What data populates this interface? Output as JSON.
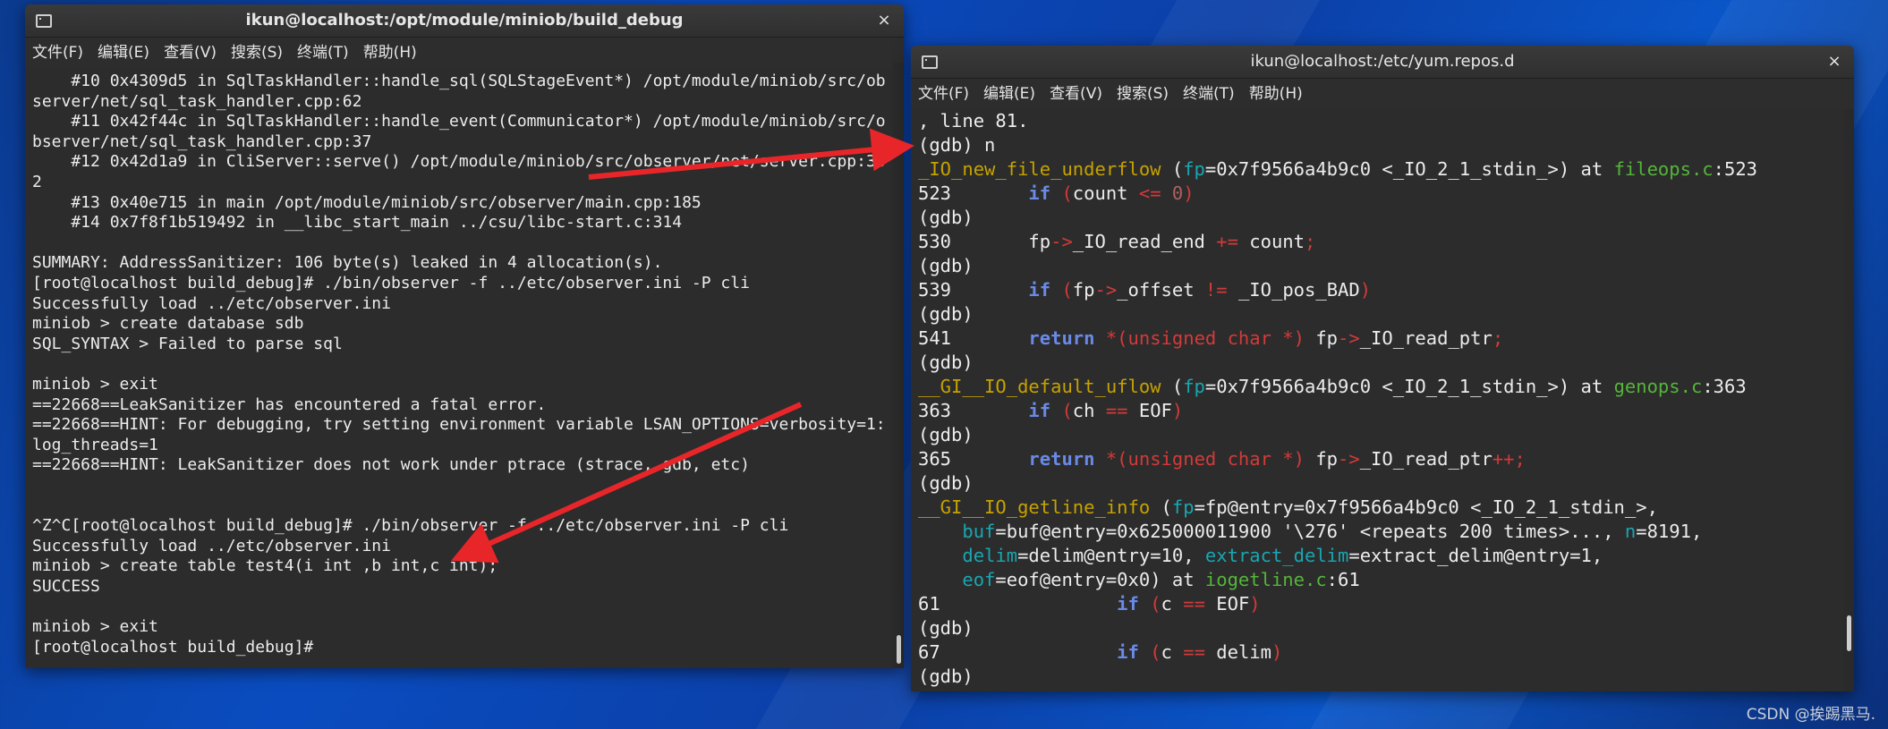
{
  "desktop": {
    "watermark": "CSDN @挨踢黑马."
  },
  "left_window": {
    "title": "ikun@localhost:/opt/module/miniob/build_debug",
    "close": "×",
    "menu": [
      "文件(F)",
      "编辑(E)",
      "查看(V)",
      "搜索(S)",
      "终端(T)",
      "帮助(H)"
    ],
    "lines": [
      "    #10 0x4309d5 in SqlTaskHandler::handle_sql(SQLStageEvent*) /opt/module/miniob/src/ob",
      "server/net/sql_task_handler.cpp:62",
      "    #11 0x42f44c in SqlTaskHandler::handle_event(Communicator*) /opt/module/miniob/src/o",
      "bserver/net/sql_task_handler.cpp:37",
      "    #12 0x42d1a9 in CliServer::serve() /opt/module/miniob/src/observer/net/server.cpp:33",
      "2",
      "    #13 0x40e715 in main /opt/module/miniob/src/observer/main.cpp:185",
      "    #14 0x7f8f1b519492 in __libc_start_main ../csu/libc-start.c:314",
      "",
      "SUMMARY: AddressSanitizer: 106 byte(s) leaked in 4 allocation(s).",
      "[root@localhost build_debug]# ./bin/observer -f ../etc/observer.ini -P cli",
      "Successfully load ../etc/observer.ini",
      "miniob > create database sdb",
      "SQL_SYNTAX > Failed to parse sql",
      "",
      "miniob > exit",
      "==22668==LeakSanitizer has encountered a fatal error.",
      "==22668==HINT: For debugging, try setting environment variable LSAN_OPTIONS=verbosity=1:",
      "log_threads=1",
      "==22668==HINT: LeakSanitizer does not work under ptrace (strace, gdb, etc)",
      "",
      "",
      "^Z^C[root@localhost build_debug]# ./bin/observer -f ../etc/observer.ini -P cli",
      "Successfully load ../etc/observer.ini",
      "miniob > create table test4(i int ,b int,c int);",
      "SUCCESS",
      "",
      "miniob > exit",
      "[root@localhost build_debug]#"
    ]
  },
  "right_window": {
    "title": "ikun@localhost:/etc/yum.repos.d",
    "close": "×",
    "menu": [
      "文件(F)",
      "编辑(E)",
      "查看(V)",
      "搜索(S)",
      "终端(T)",
      "帮助(H)"
    ],
    "lines": [
      [
        {
          "t": ", line 81."
        }
      ],
      [
        {
          "t": "(gdb) n"
        }
      ],
      [
        {
          "t": "_IO_new_file_underflow",
          "c": "c-fn"
        },
        {
          "t": " ("
        },
        {
          "t": "fp",
          "c": "c-arg"
        },
        {
          "t": "=0x7f9566a4b9c0 <_IO_2_1_stdin_>) at "
        },
        {
          "t": "fileops.c",
          "c": "c-file"
        },
        {
          "t": ":523"
        }
      ],
      [
        {
          "t": "523       "
        },
        {
          "t": "if",
          "c": "c-kw"
        },
        {
          "t": " "
        },
        {
          "t": "(",
          "c": "c-op"
        },
        {
          "t": "count "
        },
        {
          "t": "<=",
          "c": "c-op"
        },
        {
          "t": " "
        },
        {
          "t": "0",
          "c": "c-num"
        },
        {
          "t": ")",
          "c": "c-op"
        }
      ],
      [
        {
          "t": "(gdb)"
        }
      ],
      [
        {
          "t": "530       fp"
        },
        {
          "t": "->",
          "c": "c-op"
        },
        {
          "t": "_IO_read_end "
        },
        {
          "t": "+=",
          "c": "c-op"
        },
        {
          "t": " count"
        },
        {
          "t": ";",
          "c": "c-op"
        }
      ],
      [
        {
          "t": "(gdb)"
        }
      ],
      [
        {
          "t": "539       "
        },
        {
          "t": "if",
          "c": "c-kw"
        },
        {
          "t": " "
        },
        {
          "t": "(",
          "c": "c-op"
        },
        {
          "t": "fp"
        },
        {
          "t": "->",
          "c": "c-op"
        },
        {
          "t": "_offset "
        },
        {
          "t": "!=",
          "c": "c-op"
        },
        {
          "t": " _IO_pos_BAD"
        },
        {
          "t": ")",
          "c": "c-op"
        }
      ],
      [
        {
          "t": "(gdb)"
        }
      ],
      [
        {
          "t": "541       "
        },
        {
          "t": "return",
          "c": "c-kw"
        },
        {
          "t": " "
        },
        {
          "t": "*(unsigned char *)",
          "c": "c-op"
        },
        {
          "t": " fp"
        },
        {
          "t": "->",
          "c": "c-op"
        },
        {
          "t": "_IO_read_ptr"
        },
        {
          "t": ";",
          "c": "c-op"
        }
      ],
      [
        {
          "t": "(gdb)"
        }
      ],
      [
        {
          "t": "__GI__IO_default_uflow",
          "c": "c-fn"
        },
        {
          "t": " ("
        },
        {
          "t": "fp",
          "c": "c-arg"
        },
        {
          "t": "=0x7f9566a4b9c0 <_IO_2_1_stdin_>) at "
        },
        {
          "t": "genops.c",
          "c": "c-file"
        },
        {
          "t": ":363"
        }
      ],
      [
        {
          "t": "363       "
        },
        {
          "t": "if",
          "c": "c-kw"
        },
        {
          "t": " "
        },
        {
          "t": "(",
          "c": "c-op"
        },
        {
          "t": "ch "
        },
        {
          "t": "==",
          "c": "c-op"
        },
        {
          "t": " EOF"
        },
        {
          "t": ")",
          "c": "c-op"
        }
      ],
      [
        {
          "t": "(gdb)"
        }
      ],
      [
        {
          "t": "365       "
        },
        {
          "t": "return",
          "c": "c-kw"
        },
        {
          "t": " "
        },
        {
          "t": "*(unsigned char *)",
          "c": "c-op"
        },
        {
          "t": " fp"
        },
        {
          "t": "->",
          "c": "c-op"
        },
        {
          "t": "_IO_read_ptr"
        },
        {
          "t": "++;",
          "c": "c-op"
        }
      ],
      [
        {
          "t": "(gdb)"
        }
      ],
      [
        {
          "t": "__GI__IO_getline_info",
          "c": "c-fn"
        },
        {
          "t": " ("
        },
        {
          "t": "fp",
          "c": "c-arg"
        },
        {
          "t": "=fp@entry=0x7f9566a4b9c0 <_IO_2_1_stdin_>,"
        }
      ],
      [
        {
          "t": "    "
        },
        {
          "t": "buf",
          "c": "c-arg"
        },
        {
          "t": "=buf@entry=0x625000011900 '\\276' <repeats 200 times>..., "
        },
        {
          "t": "n",
          "c": "c-arg"
        },
        {
          "t": "=8191,"
        }
      ],
      [
        {
          "t": "    "
        },
        {
          "t": "delim",
          "c": "c-arg"
        },
        {
          "t": "=delim@entry=10, "
        },
        {
          "t": "extract_delim",
          "c": "c-arg"
        },
        {
          "t": "=extract_delim@entry=1,"
        }
      ],
      [
        {
          "t": "    "
        },
        {
          "t": "eof",
          "c": "c-arg"
        },
        {
          "t": "=eof@entry=0x0) at "
        },
        {
          "t": "iogetline.c",
          "c": "c-file"
        },
        {
          "t": ":61"
        }
      ],
      [
        {
          "t": "61                "
        },
        {
          "t": "if",
          "c": "c-kw"
        },
        {
          "t": " "
        },
        {
          "t": "(",
          "c": "c-op"
        },
        {
          "t": "c "
        },
        {
          "t": "==",
          "c": "c-op"
        },
        {
          "t": " EOF"
        },
        {
          "t": ")",
          "c": "c-op"
        }
      ],
      [
        {
          "t": "(gdb)"
        }
      ],
      [
        {
          "t": "67                "
        },
        {
          "t": "if",
          "c": "c-kw"
        },
        {
          "t": " "
        },
        {
          "t": "(",
          "c": "c-op"
        },
        {
          "t": "c "
        },
        {
          "t": "==",
          "c": "c-op"
        },
        {
          "t": " delim"
        },
        {
          "t": ")",
          "c": "c-op"
        }
      ],
      [
        {
          "t": "(gdb)"
        }
      ]
    ]
  },
  "colors": {
    "annotation_arrow": "#e8262a",
    "terminal_bg": "#2c2c2c"
  }
}
